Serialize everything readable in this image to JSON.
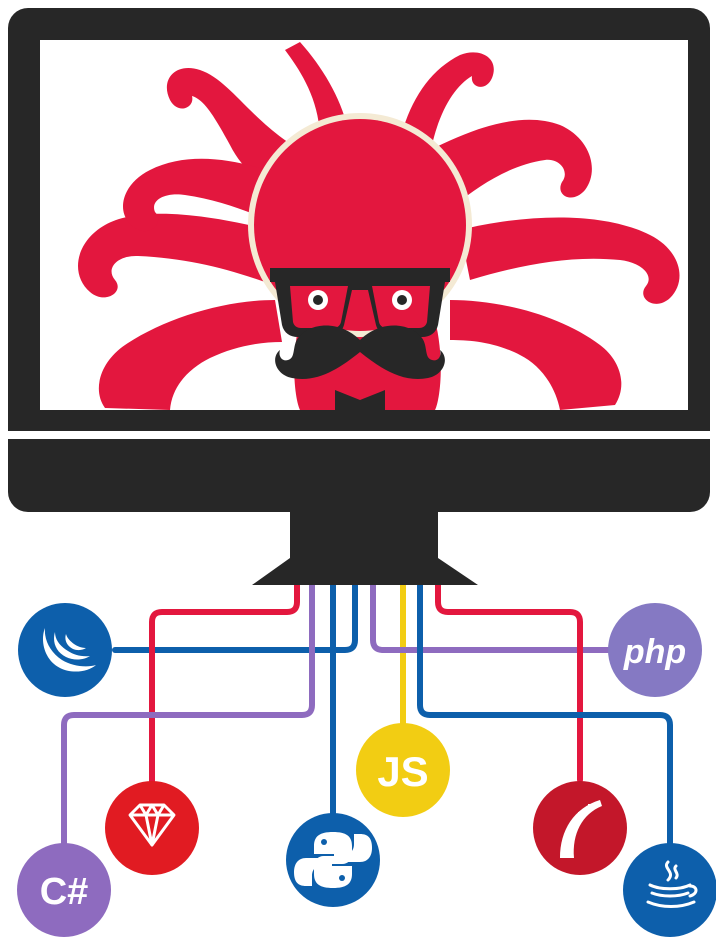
{
  "illustration": {
    "monitor": {
      "bezel_color": "#272727",
      "screen_color": "#ffffff",
      "mascot_color": "#e3173e",
      "mascot_outline_color": "#f4ead4"
    },
    "badges": [
      {
        "name": "jquery",
        "icon": "jquery-icon",
        "label": "",
        "color": "#0d5fab"
      },
      {
        "name": "php",
        "icon": "php-icon",
        "label": "php",
        "color": "#8579c3"
      },
      {
        "name": "ruby",
        "icon": "ruby-gem-icon",
        "label": "",
        "color": "#e11b22"
      },
      {
        "name": "javascript",
        "icon": "js-icon",
        "label": "JS",
        "color": "#f2cd13"
      },
      {
        "name": "rails",
        "icon": "rails-icon",
        "label": "",
        "color": "#c3172a"
      },
      {
        "name": "python",
        "icon": "python-icon",
        "label": "",
        "color": "#0d5fab"
      },
      {
        "name": "csharp",
        "icon": "csharp-icon",
        "label": "C#",
        "color": "#8e6bbf"
      },
      {
        "name": "java",
        "icon": "java-icon",
        "label": "",
        "color": "#0d5fab"
      }
    ],
    "cable_colors": {
      "red": "#e3173e",
      "purple": "#8e6bbf",
      "blue": "#0d5fab",
      "yellow": "#f2cd13"
    }
  }
}
